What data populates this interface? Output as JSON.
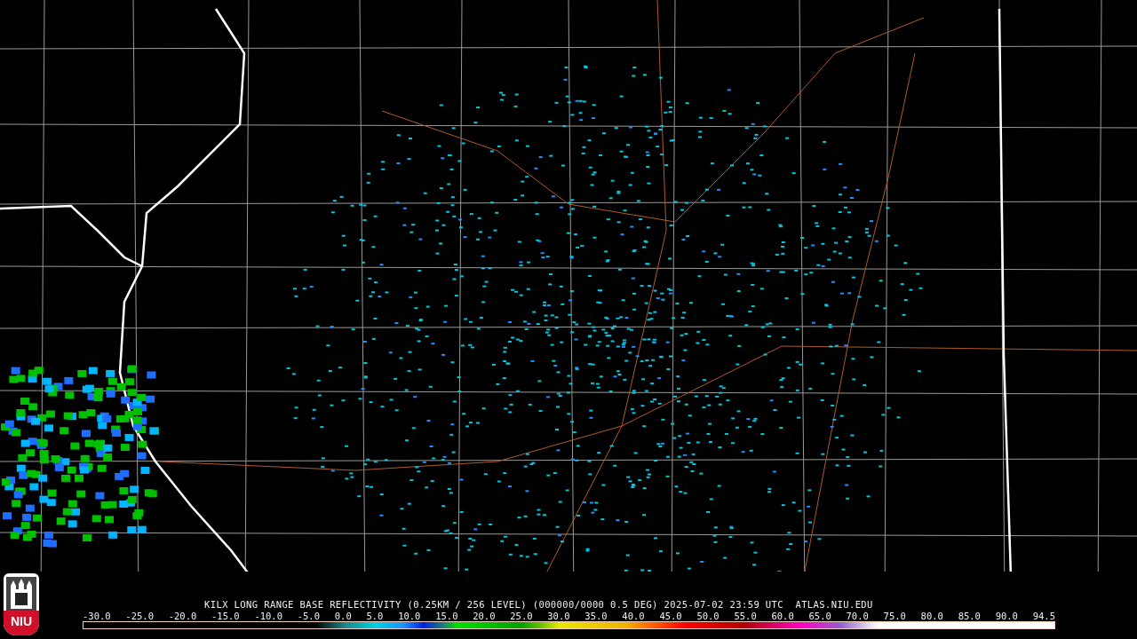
{
  "caption": "KILX LONG RANGE BASE REFLECTIVITY (0.25KM / 256 LEVEL) (000000/0000 0.5 DEG) 2025-07-02 23:59 UTC  ATLAS.NIU.EDU",
  "logo": {
    "text": "NIU"
  },
  "scale_labels": [
    "-30.0",
    "-25.0",
    "-20.0",
    "-15.0",
    "-10.0",
    "-5.0",
    "0.0",
    "5.0",
    "10.0",
    "15.0",
    "20.0",
    "25.0",
    "30.0",
    "35.0",
    "40.0",
    "45.0",
    "50.0",
    "55.0",
    "60.0",
    "65.0",
    "70.0",
    "75.0",
    "80.0",
    "85.0",
    "90.0",
    "94.5"
  ]
}
